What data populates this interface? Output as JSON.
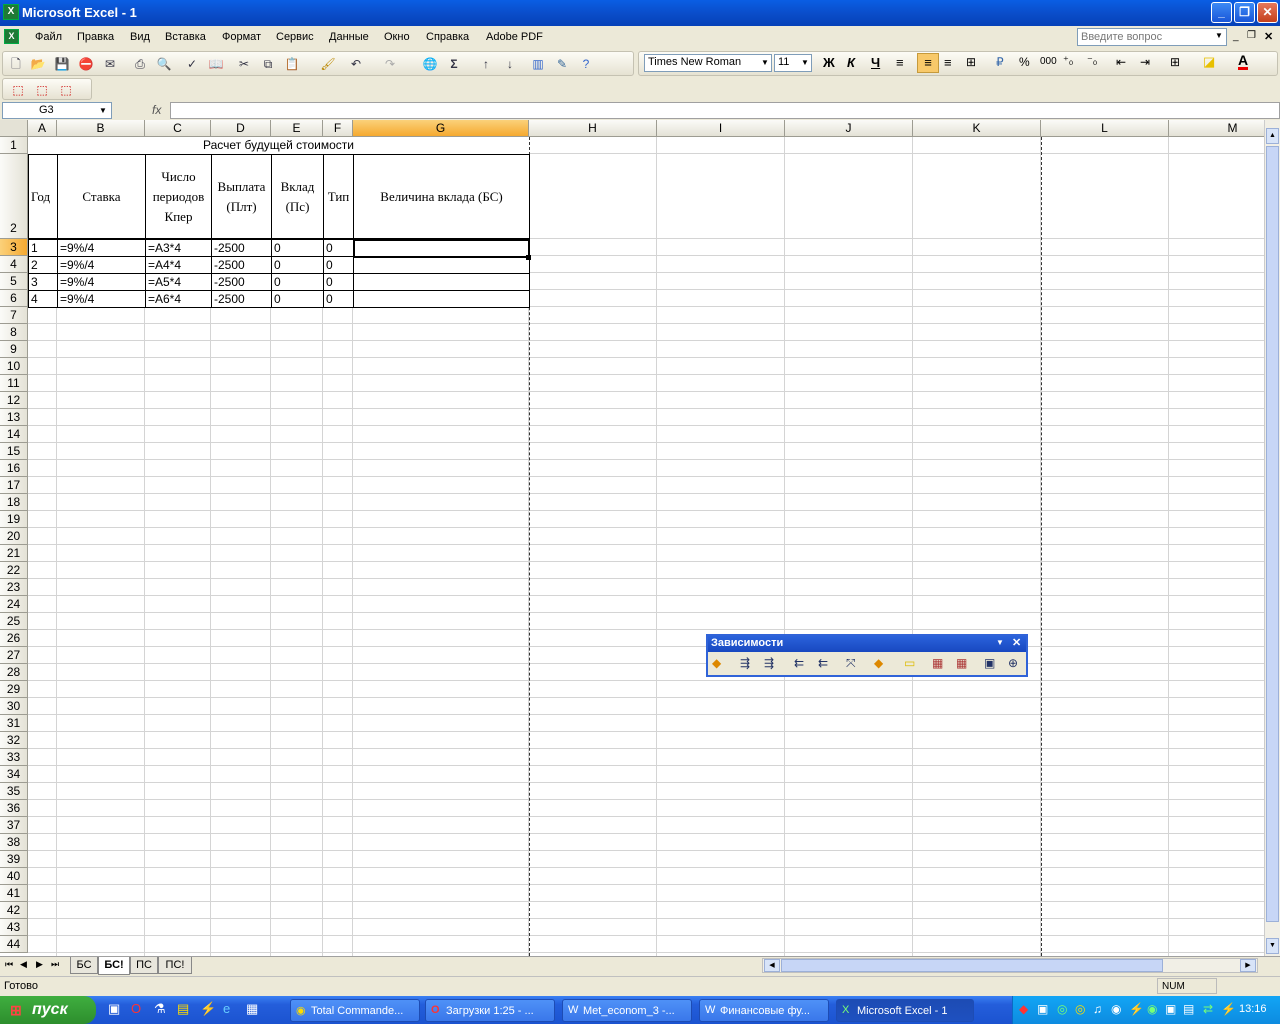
{
  "window": {
    "title": "Microsoft Excel - 1",
    "icon": "excel-icon"
  },
  "menu": {
    "items": [
      "Файл",
      "Правка",
      "Вид",
      "Вставка",
      "Формат",
      "Сервис",
      "Данные",
      "Окно",
      "Справка",
      "Adobe PDF"
    ],
    "ask_placeholder": "Введите вопрос"
  },
  "format": {
    "font": "Times New Roman",
    "size": "11",
    "bold": "Ж",
    "italic": "К",
    "underline": "Ч",
    "percent": "%",
    "thousands": "000"
  },
  "formula": {
    "cell_ref": "G3",
    "fx": "fx",
    "value": ""
  },
  "columns": [
    "A",
    "B",
    "C",
    "D",
    "E",
    "F",
    "G",
    "H",
    "I",
    "J",
    "K",
    "L",
    "M"
  ],
  "rows": [
    "1",
    "2",
    "3",
    "4",
    "5",
    "6",
    "7",
    "8",
    "9",
    "10",
    "11",
    "12",
    "13",
    "14",
    "15",
    "16",
    "17",
    "18",
    "19",
    "20",
    "21",
    "22",
    "23",
    "24",
    "25",
    "26",
    "27",
    "28",
    "29",
    "30",
    "31",
    "32",
    "33",
    "34",
    "35",
    "36",
    "37",
    "38",
    "39",
    "40",
    "41",
    "42",
    "43",
    "44"
  ],
  "sheet": {
    "title": "Расчет будущей стоимости",
    "headers": {
      "a": "Год",
      "b": "Ставка",
      "c1": "Число",
      "c2": "периодов",
      "c3": "Кпер",
      "d1": "Выплата",
      "d2": "(Плт)",
      "e1": "Вклад",
      "e2": "(Пс)",
      "f": "Тип",
      "g": "Величина вклада (БС)"
    },
    "data": [
      [
        "1",
        "=9%/4",
        "=A3*4",
        "-2500",
        "0",
        "0"
      ],
      [
        "2",
        "=9%/4",
        "=A4*4",
        "-2500",
        "0",
        "0"
      ],
      [
        "3",
        "=9%/4",
        "=A5*4",
        "-2500",
        "0",
        "0"
      ],
      [
        "4",
        "=9%/4",
        "=A6*4",
        "-2500",
        "0",
        "0"
      ]
    ]
  },
  "tabs": [
    "БС",
    "БС!",
    "ПС",
    "ПС!"
  ],
  "status": {
    "left": "Готово",
    "num": "NUM"
  },
  "dependencies": {
    "title": "Зависимости"
  },
  "taskbar": {
    "start": "пуск",
    "tasks": [
      "Total Comma​nde...",
      "Загрузки 1:25 - ...",
      "Met_econom_3 -...",
      "Финансовые фу...",
      "Microsoft Excel - 1"
    ],
    "clock": "13:16"
  }
}
